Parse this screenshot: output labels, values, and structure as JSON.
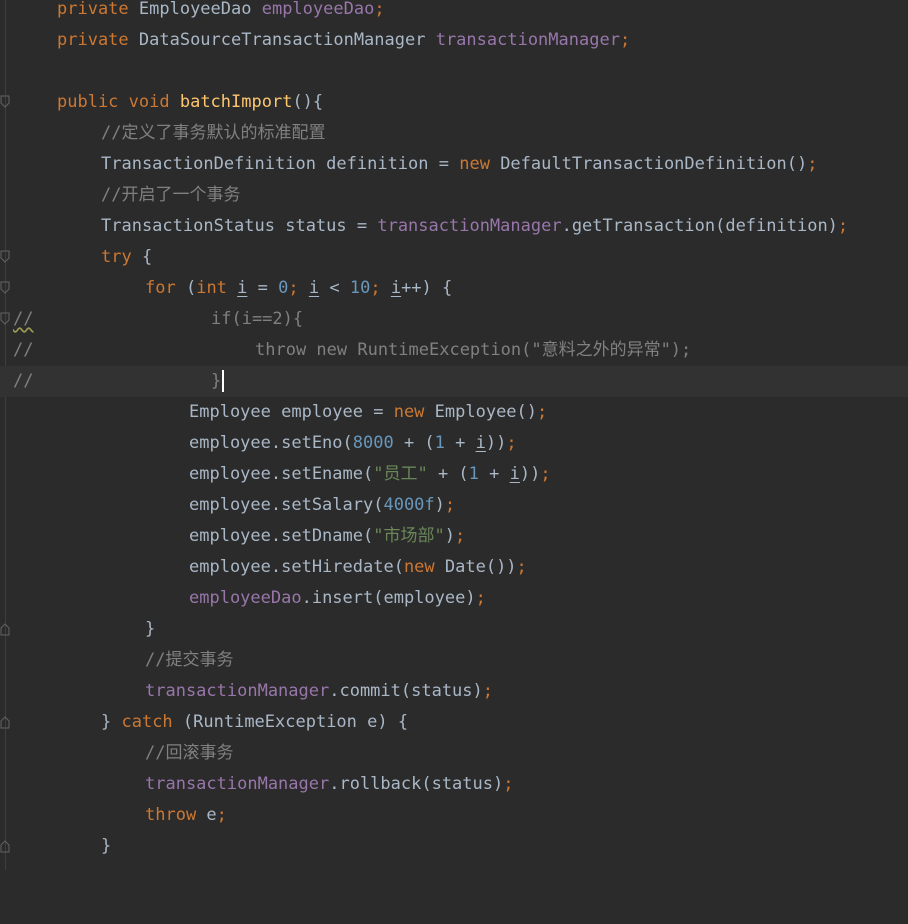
{
  "editor": {
    "theme_colors": {
      "background": "#2b2b2b",
      "keyword": "#cc7832",
      "method": "#ffc66d",
      "field": "#9876aa",
      "number": "#6897bb",
      "string": "#6a8759",
      "comment": "#808080",
      "plain": "#a9b7c6"
    },
    "lines": {
      "l1": {
        "kw": "private",
        "type": " EmployeeDao ",
        "field": "employeeDao",
        "semi": ";"
      },
      "l2": {
        "kw": "private",
        "type": " DataSourceTransactionManager ",
        "field": "transactionManager",
        "semi": ";"
      },
      "l4": {
        "kw1": "public",
        "kw2": " void ",
        "fn": "batchImport",
        "rest": "(){"
      },
      "l5": {
        "comment": "//定义了事务默认的标准配置"
      },
      "l6": {
        "pre": "TransactionDefinition definition = ",
        "kw": "new",
        "post": " DefaultTransactionDefinition()",
        "semi": ";"
      },
      "l7": {
        "comment": "//开启了一个事务"
      },
      "l8": {
        "pre": "TransactionStatus status = ",
        "field": "transactionManager",
        "post": ".getTransaction(definition)",
        "semi": ";"
      },
      "l9": {
        "kw": "try",
        "rest": " {"
      },
      "l10": {
        "kw": "for",
        "p1": " (",
        "kw2": "int",
        "v1": "i",
        "p2": " = ",
        "n1": "0",
        "s1": "; ",
        "v2": "i",
        "p3": " < ",
        "n2": "10",
        "s2": "; ",
        "v3": "i",
        "p4": "++) {"
      },
      "l11": {
        "gutter": "//",
        "code": "if(i==2){"
      },
      "l12": {
        "gutter": "//",
        "code": "throw new RuntimeException(\"意料之外的异常\");"
      },
      "l13": {
        "gutter": "//",
        "code": "}"
      },
      "l14": {
        "pre": "Employee employee = ",
        "kw": "new",
        "post": " Employee()",
        "semi": ";"
      },
      "l15": {
        "pre": "employee.setEno(",
        "n1": "8000",
        "p2": " + (",
        "n2": "1",
        "p3": " + ",
        "v": "i",
        "p4": "))",
        "semi": ";"
      },
      "l16": {
        "pre": "employee.setEname(",
        "str": "\"员工\"",
        "p2": " + (",
        "n": "1",
        "p3": " + ",
        "v": "i",
        "p4": "))",
        "semi": ";"
      },
      "l17": {
        "pre": "employee.setSalary(",
        "n": "4000f",
        "p2": ")",
        "semi": ";"
      },
      "l18": {
        "pre": "employee.setDname(",
        "str": "\"市场部\"",
        "p2": ")",
        "semi": ";"
      },
      "l19": {
        "pre": "employee.setHiredate(",
        "kw": "new",
        "post": " Date())",
        "semi": ";"
      },
      "l20": {
        "field": "employeeDao",
        "post": ".insert(employee)",
        "semi": ";"
      },
      "l21": {
        "code": "}"
      },
      "l22": {
        "comment": "//提交事务"
      },
      "l23": {
        "field": "transactionManager",
        "post": ".commit(status)",
        "semi": ";"
      },
      "l24": {
        "p1": "} ",
        "kw": "catch",
        "post": " (RuntimeException e) {"
      },
      "l25": {
        "comment": "//回滚事务"
      },
      "l26": {
        "field": "transactionManager",
        "post": ".rollback(status)",
        "semi": ";"
      },
      "l27": {
        "kw": "throw",
        "post": " e",
        "semi": ";"
      },
      "l28": {
        "code": "}"
      }
    }
  }
}
